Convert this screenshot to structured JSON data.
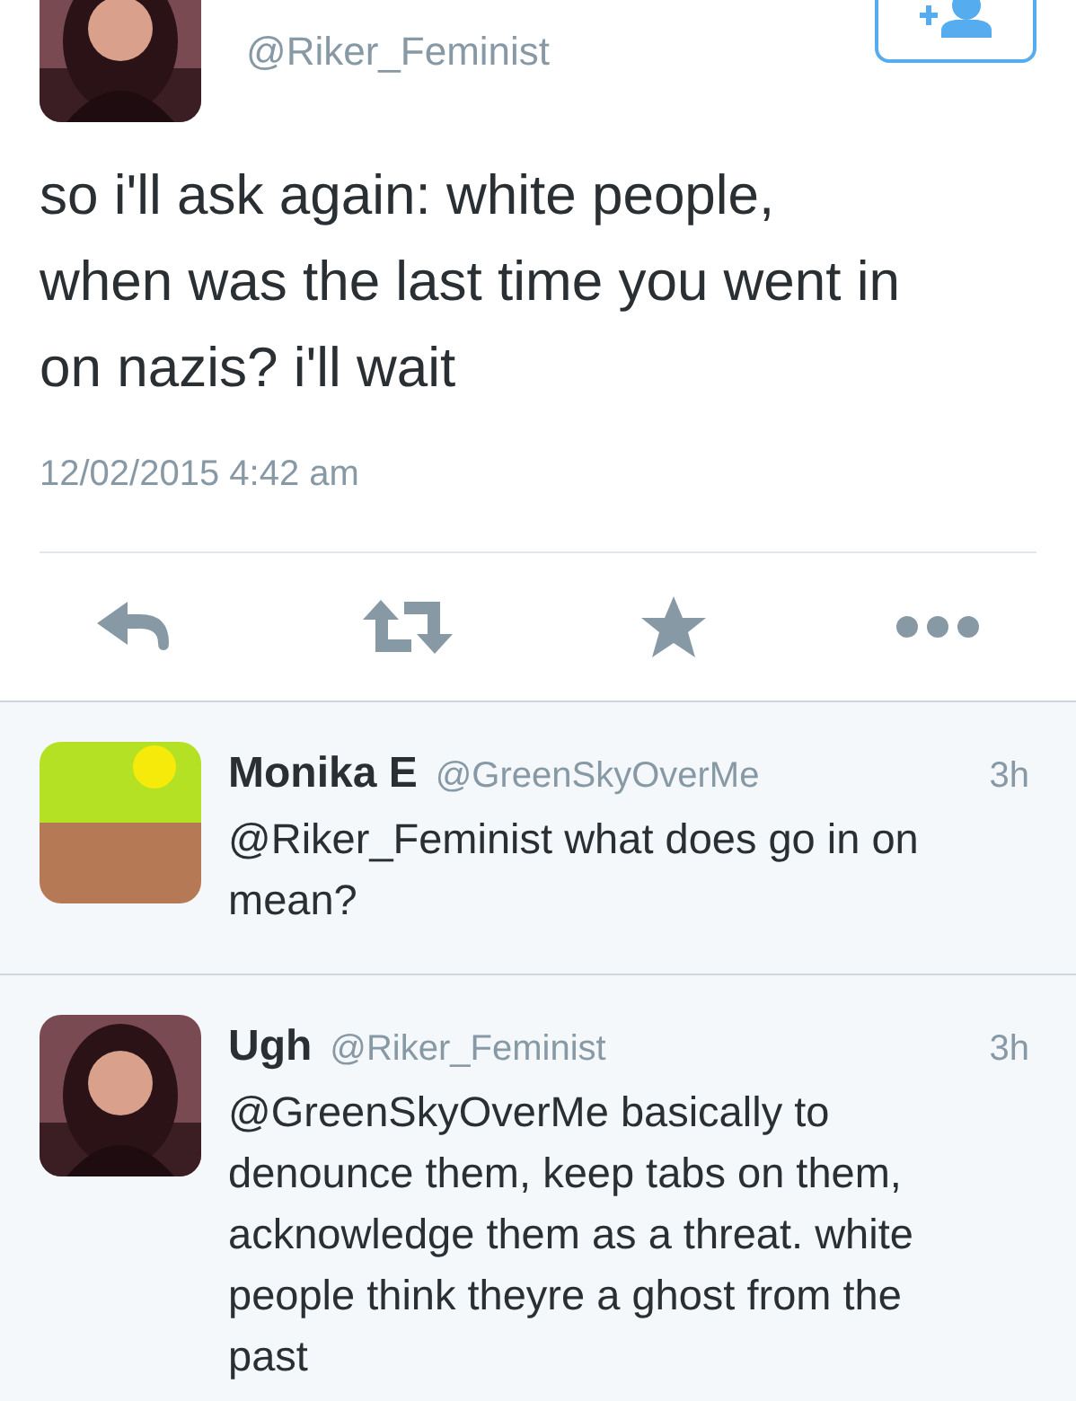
{
  "tweet": {
    "handle": "@Riker_Feminist",
    "text": "so i'll ask again: white people, when was the last time you went in on nazis? i'll wait",
    "timestamp": "12/02/2015 4:42 am"
  },
  "replies": [
    {
      "name": "Monika E",
      "handle": "@GreenSkyOverMe",
      "time": "3h",
      "text": "@Riker_Feminist what does go in on mean?"
    },
    {
      "name": "Ugh",
      "handle": "@Riker_Feminist",
      "time": "3h",
      "text": "@GreenSkyOverMe basically to denounce them, keep tabs on them, acknowledge them as a threat. white people think theyre a ghost from the past"
    }
  ]
}
